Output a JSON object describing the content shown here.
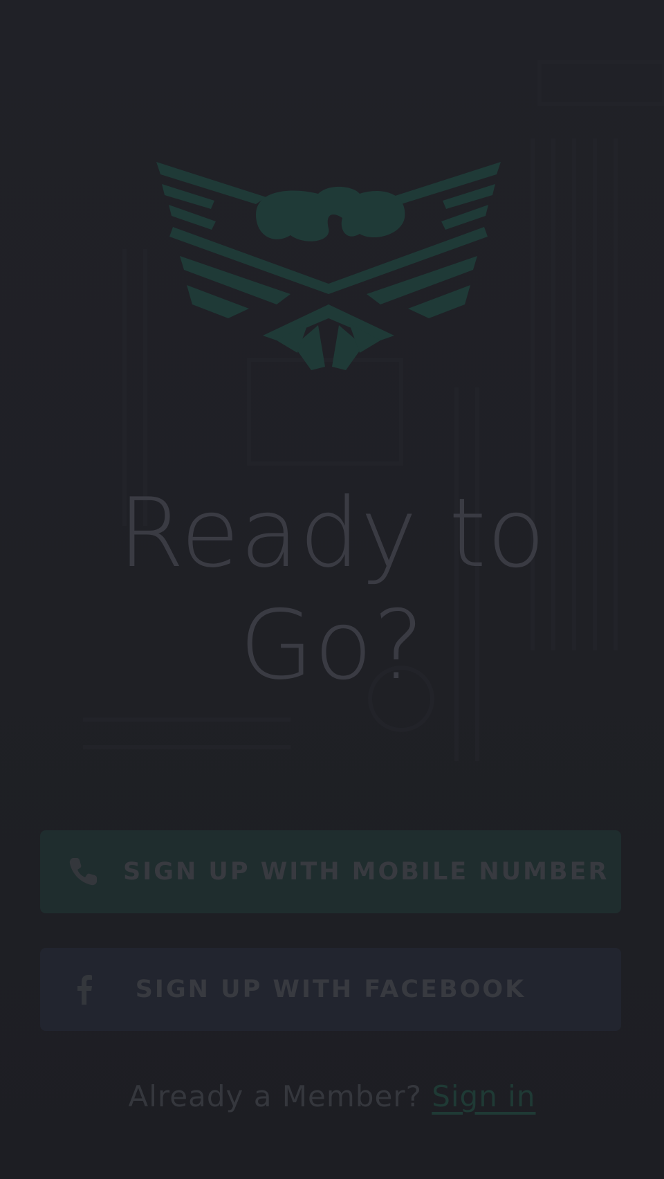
{
  "headline": {
    "line1": "Ready to",
    "line2": "Go?"
  },
  "buttons": {
    "mobile": {
      "label": "SIGN UP WITH MOBILE NUMBER",
      "icon": "phone-icon"
    },
    "facebook": {
      "label": "SIGN UP WITH FACEBOOK",
      "icon": "facebook-icon"
    }
  },
  "signin": {
    "prompt": "Already a Member?",
    "link": "Sign in"
  },
  "logo": {
    "icon": "eagle-emblem-logo"
  },
  "colors": {
    "background": "#1f2026",
    "logo": "#1f3a37",
    "mobile_button": "#1f2d2e",
    "facebook_button": "#22252f",
    "link": "#1f3a35",
    "text": "#3a3b43"
  }
}
